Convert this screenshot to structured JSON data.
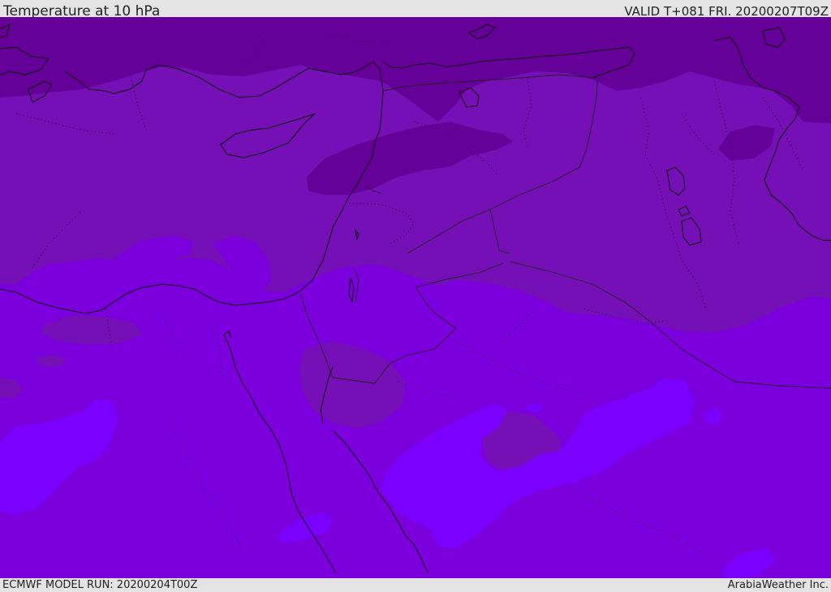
{
  "header": {
    "title": "Temperature at 10 hPa",
    "valid": "VALID T+081 FRI. 20200207T09Z"
  },
  "footer": {
    "model_run": "ECMWF MODEL RUN: 20200204T00Z",
    "credit": "ArabiaWeather Inc."
  },
  "colors": {
    "level_coldest": "#650099",
    "level_cold": "#7410b5",
    "level_mid": "#7b00dd",
    "level_warm": "#7a00ff",
    "coast_line": "#111111",
    "border_line": "#222222"
  }
}
